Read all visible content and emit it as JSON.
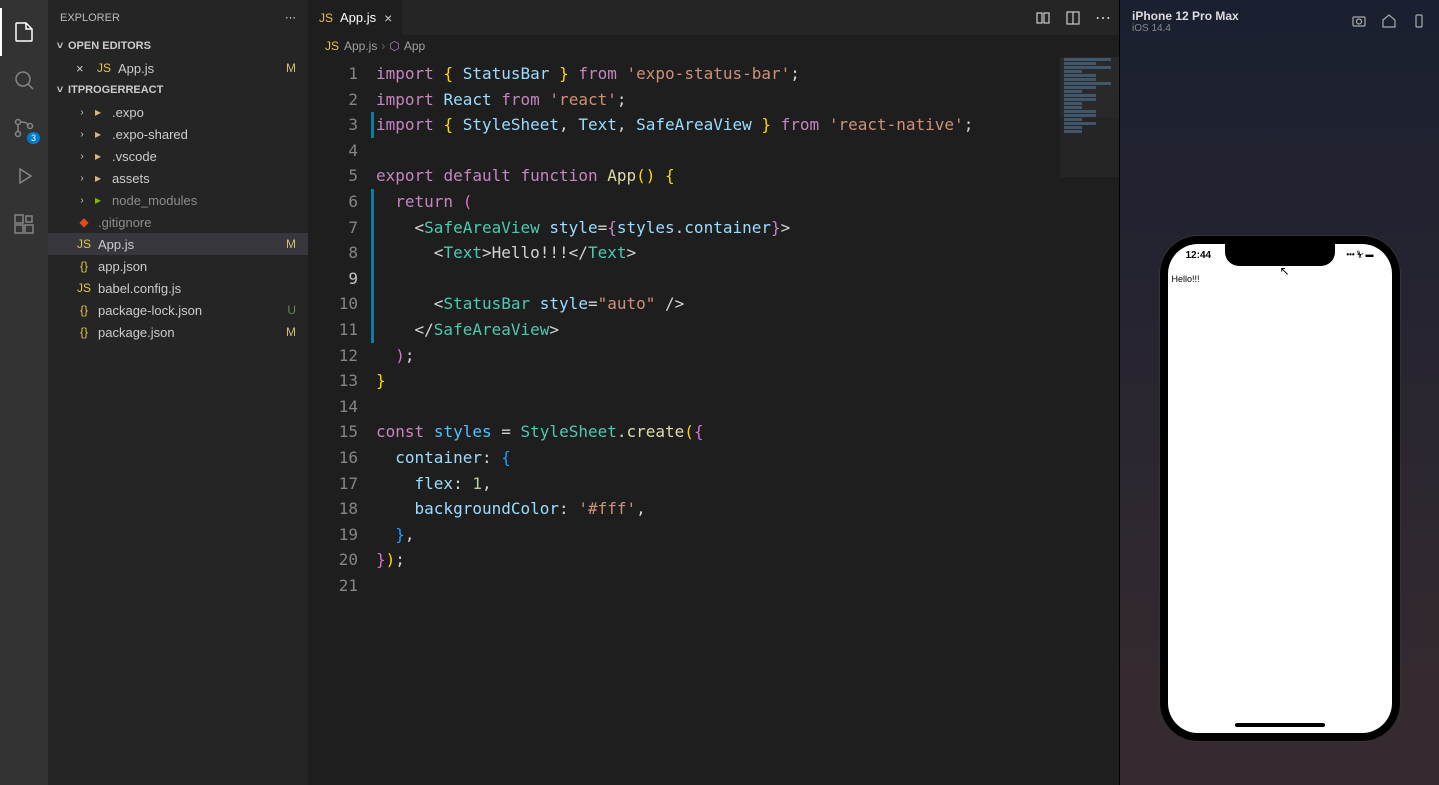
{
  "activityBar": {
    "scmBadge": "3"
  },
  "sidebar": {
    "title": "EXPLORER",
    "openEditors": {
      "label": "OPEN EDITORS",
      "items": [
        {
          "name": "App.js",
          "status": "M"
        }
      ]
    },
    "project": {
      "label": "ITPROGERREACT",
      "items": [
        {
          "name": ".expo",
          "type": "folder",
          "indent": 1
        },
        {
          "name": ".expo-shared",
          "type": "folder",
          "indent": 1
        },
        {
          "name": ".vscode",
          "type": "folder",
          "indent": 1
        },
        {
          "name": "assets",
          "type": "folder",
          "indent": 1
        },
        {
          "name": "node_modules",
          "type": "folder-green",
          "indent": 1,
          "dim": true
        },
        {
          "name": ".gitignore",
          "type": "git",
          "indent": 1,
          "dim": true
        },
        {
          "name": "App.js",
          "type": "js",
          "indent": 1,
          "status": "M",
          "active": true
        },
        {
          "name": "app.json",
          "type": "json",
          "indent": 1
        },
        {
          "name": "babel.config.js",
          "type": "js",
          "indent": 1
        },
        {
          "name": "package-lock.json",
          "type": "json",
          "indent": 1,
          "status": "U"
        },
        {
          "name": "package.json",
          "type": "json",
          "indent": 1,
          "status": "M"
        }
      ]
    }
  },
  "tabs": [
    {
      "name": "App.js"
    }
  ],
  "breadcrumb": {
    "file": "App.js",
    "symbol": "App"
  },
  "code": {
    "lines": [
      {
        "n": 1,
        "html": "<span class='tk-kw'>import</span> <span class='tk-brace'>{</span> <span class='tk-var'>StatusBar</span> <span class='tk-brace'>}</span> <span class='tk-kw'>from</span> <span class='tk-str'>'expo-status-bar'</span><span class='tk-pun'>;</span>"
      },
      {
        "n": 2,
        "html": "<span class='tk-kw'>import</span> <span class='tk-var'>React</span> <span class='tk-kw'>from</span> <span class='tk-str'>'react'</span><span class='tk-pun'>;</span>"
      },
      {
        "n": 3,
        "mod": true,
        "html": "<span class='tk-kw'>import</span> <span class='tk-brace'>{</span> <span class='tk-var'>StyleSheet</span><span class='tk-pun'>,</span> <span class='tk-var'>Text</span><span class='tk-pun'>,</span> <span class='tk-var'>SafeAreaView</span> <span class='tk-brace'>}</span> <span class='tk-kw'>from</span> <span class='tk-str'>'react-native'</span><span class='tk-pun'>;</span>"
      },
      {
        "n": 4,
        "html": ""
      },
      {
        "n": 5,
        "html": "<span class='tk-kw'>export</span> <span class='tk-kw'>default</span> <span class='tk-kw'>function</span> <span class='tk-fn'>App</span><span class='tk-brace'>()</span> <span class='tk-brace'>{</span>"
      },
      {
        "n": 6,
        "mod": true,
        "html": "  <span class='tk-kw'>return</span> <span class='tk-brace2'>(</span>"
      },
      {
        "n": 7,
        "mod": true,
        "html": "    <span class='tk-pun'>&lt;</span><span class='tk-tag'>SafeAreaView</span> <span class='tk-attr'>style</span><span class='tk-pun'>=</span><span class='tk-kw'>{</span><span class='tk-var'>styles</span><span class='tk-pun'>.</span><span class='tk-var'>container</span><span class='tk-kw'>}</span><span class='tk-pun'>&gt;</span>"
      },
      {
        "n": 8,
        "mod": true,
        "html": "      <span class='tk-pun'>&lt;</span><span class='tk-tag'>Text</span><span class='tk-pun'>&gt;</span>Hello!!!<span class='tk-pun'>&lt;/</span><span class='tk-tag'>Text</span><span class='tk-pun'>&gt;</span>"
      },
      {
        "n": 9,
        "mod": true,
        "cursor": true,
        "html": "      "
      },
      {
        "n": 10,
        "mod": true,
        "html": "      <span class='tk-pun'>&lt;</span><span class='tk-tag'>StatusBar</span> <span class='tk-attr'>style</span><span class='tk-pun'>=</span><span class='tk-str'>\"auto\"</span> <span class='tk-pun'>/&gt;</span>"
      },
      {
        "n": 11,
        "mod": true,
        "html": "    <span class='tk-pun'>&lt;/</span><span class='tk-tag'>SafeAreaView</span><span class='tk-pun'>&gt;</span>"
      },
      {
        "n": 12,
        "html": "  <span class='tk-brace2'>)</span><span class='tk-pun'>;</span>"
      },
      {
        "n": 13,
        "html": "<span class='tk-brace'>}</span>"
      },
      {
        "n": 14,
        "html": ""
      },
      {
        "n": 15,
        "html": "<span class='tk-kw'>const</span> <span class='tk-const'>styles</span> <span class='tk-pun'>=</span> <span class='tk-type'>StyleSheet</span><span class='tk-pun'>.</span><span class='tk-fn'>create</span><span class='tk-brace'>(</span><span class='tk-brace2'>{</span>"
      },
      {
        "n": 16,
        "html": "  <span class='tk-var'>container</span><span class='tk-pun'>:</span> <span class='tk-brace3'>{</span>"
      },
      {
        "n": 17,
        "html": "    <span class='tk-var'>flex</span><span class='tk-pun'>:</span> <span class='tk-num'>1</span><span class='tk-pun'>,</span>"
      },
      {
        "n": 18,
        "html": "    <span class='tk-var'>backgroundColor</span><span class='tk-pun'>:</span> <span class='tk-str'>'#fff'</span><span class='tk-pun'>,</span>"
      },
      {
        "n": 19,
        "html": "  <span class='tk-brace3'>}</span><span class='tk-pun'>,</span>"
      },
      {
        "n": 20,
        "html": "<span class='tk-brace2'>}</span><span class='tk-brace'>)</span><span class='tk-pun'>;</span>"
      },
      {
        "n": 21,
        "html": ""
      }
    ]
  },
  "simulator": {
    "device": "iPhone 12 Pro Max",
    "os": "iOS 14.4",
    "time": "12:44",
    "appText": "Hello!!!"
  }
}
